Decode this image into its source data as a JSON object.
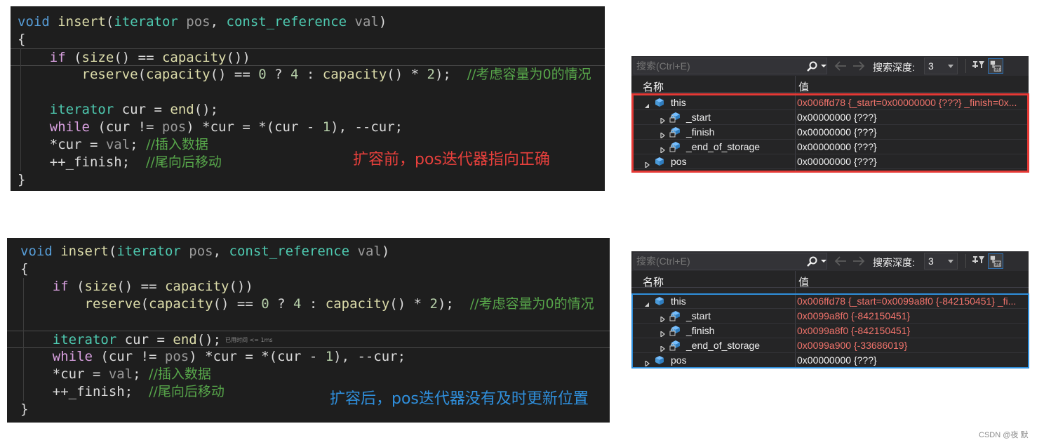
{
  "code_top": {
    "lines": [
      {
        "tokens": [
          {
            "c": "kw",
            "t": "void"
          },
          {
            "c": "var",
            "t": " "
          },
          {
            "c": "fn",
            "t": "insert"
          },
          {
            "c": "var",
            "t": "("
          },
          {
            "c": "ty",
            "t": "iterator"
          },
          {
            "c": "var",
            "t": " "
          },
          {
            "c": "prm",
            "t": "pos"
          },
          {
            "c": "var",
            "t": ", "
          },
          {
            "c": "ty",
            "t": "const_reference"
          },
          {
            "c": "var",
            "t": " "
          },
          {
            "c": "prm",
            "t": "val"
          },
          {
            "c": "var",
            "t": ")"
          }
        ]
      },
      {
        "tokens": [
          {
            "c": "var",
            "t": "{"
          }
        ]
      },
      {
        "tokens": [
          {
            "c": "var",
            "t": "    "
          },
          {
            "c": "ctl",
            "t": "if"
          },
          {
            "c": "var",
            "t": " ("
          },
          {
            "c": "fn",
            "t": "size"
          },
          {
            "c": "var",
            "t": "() == "
          },
          {
            "c": "fn",
            "t": "capacity"
          },
          {
            "c": "var",
            "t": "())"
          }
        ]
      },
      {
        "tokens": [
          {
            "c": "var",
            "t": "        "
          },
          {
            "c": "fn",
            "t": "reserve"
          },
          {
            "c": "var",
            "t": "("
          },
          {
            "c": "fn",
            "t": "capacity"
          },
          {
            "c": "var",
            "t": "() == "
          },
          {
            "c": "num",
            "t": "0"
          },
          {
            "c": "var",
            "t": " ? "
          },
          {
            "c": "num",
            "t": "4"
          },
          {
            "c": "var",
            "t": " : "
          },
          {
            "c": "fn",
            "t": "capacity"
          },
          {
            "c": "var",
            "t": "() * "
          },
          {
            "c": "num",
            "t": "2"
          },
          {
            "c": "var",
            "t": ");  "
          },
          {
            "c": "cm",
            "t": "//考虑容量为0的情况"
          }
        ]
      },
      {
        "tokens": [
          {
            "c": "var",
            "t": ""
          }
        ]
      },
      {
        "tokens": [
          {
            "c": "var",
            "t": "    "
          },
          {
            "c": "ty",
            "t": "iterator"
          },
          {
            "c": "var",
            "t": " "
          },
          {
            "c": "var",
            "t": "cur"
          },
          {
            "c": "var",
            "t": " = "
          },
          {
            "c": "fn",
            "t": "end"
          },
          {
            "c": "var",
            "t": "();"
          }
        ]
      },
      {
        "tokens": [
          {
            "c": "var",
            "t": "    "
          },
          {
            "c": "ctl",
            "t": "while"
          },
          {
            "c": "var",
            "t": " (cur != "
          },
          {
            "c": "prm",
            "t": "pos"
          },
          {
            "c": "var",
            "t": ") *cur = *(cur - "
          },
          {
            "c": "num",
            "t": "1"
          },
          {
            "c": "var",
            "t": "), --cur;"
          }
        ]
      },
      {
        "tokens": [
          {
            "c": "var",
            "t": "    *cur = "
          },
          {
            "c": "prm",
            "t": "val"
          },
          {
            "c": "var",
            "t": "; "
          },
          {
            "c": "cm",
            "t": "//插入数据"
          }
        ]
      },
      {
        "tokens": [
          {
            "c": "var",
            "t": "    ++_finish;  "
          },
          {
            "c": "cm",
            "t": "//尾向后移动"
          }
        ]
      },
      {
        "tokens": [
          {
            "c": "var",
            "t": "}"
          }
        ]
      }
    ],
    "annotation": "扩容前，pos迭代器指向正确"
  },
  "code_bottom": {
    "lines": [
      {
        "tokens": [
          {
            "c": "kw",
            "t": "void"
          },
          {
            "c": "var",
            "t": " "
          },
          {
            "c": "fn",
            "t": "insert"
          },
          {
            "c": "var",
            "t": "("
          },
          {
            "c": "ty",
            "t": "iterator"
          },
          {
            "c": "var",
            "t": " "
          },
          {
            "c": "prm",
            "t": "pos"
          },
          {
            "c": "var",
            "t": ", "
          },
          {
            "c": "ty",
            "t": "const_reference"
          },
          {
            "c": "var",
            "t": " "
          },
          {
            "c": "prm",
            "t": "val"
          },
          {
            "c": "var",
            "t": ")"
          }
        ]
      },
      {
        "tokens": [
          {
            "c": "var",
            "t": "{"
          }
        ]
      },
      {
        "tokens": [
          {
            "c": "var",
            "t": "    "
          },
          {
            "c": "ctl",
            "t": "if"
          },
          {
            "c": "var",
            "t": " ("
          },
          {
            "c": "fn",
            "t": "size"
          },
          {
            "c": "var",
            "t": "() == "
          },
          {
            "c": "fn",
            "t": "capacity"
          },
          {
            "c": "var",
            "t": "())"
          }
        ]
      },
      {
        "tokens": [
          {
            "c": "var",
            "t": "        "
          },
          {
            "c": "fn",
            "t": "reserve"
          },
          {
            "c": "var",
            "t": "("
          },
          {
            "c": "fn",
            "t": "capacity"
          },
          {
            "c": "var",
            "t": "() == "
          },
          {
            "c": "num",
            "t": "0"
          },
          {
            "c": "var",
            "t": " ? "
          },
          {
            "c": "num",
            "t": "4"
          },
          {
            "c": "var",
            "t": " : "
          },
          {
            "c": "fn",
            "t": "capacity"
          },
          {
            "c": "var",
            "t": "() * "
          },
          {
            "c": "num",
            "t": "2"
          },
          {
            "c": "var",
            "t": ");  "
          },
          {
            "c": "cm",
            "t": "//考虑容量为0的情况"
          }
        ]
      },
      {
        "tokens": [
          {
            "c": "var",
            "t": ""
          }
        ]
      },
      {
        "tokens": [
          {
            "c": "var",
            "t": "    "
          },
          {
            "c": "ty",
            "t": "iterator"
          },
          {
            "c": "var",
            "t": " "
          },
          {
            "c": "var",
            "t": "cur"
          },
          {
            "c": "var",
            "t": " = "
          },
          {
            "c": "fn",
            "t": "end"
          },
          {
            "c": "var",
            "t": "();"
          }
        ],
        "hint": "已用时间 <= 1ms"
      },
      {
        "tokens": [
          {
            "c": "var",
            "t": "    "
          },
          {
            "c": "ctl",
            "t": "while"
          },
          {
            "c": "var",
            "t": " (cur != "
          },
          {
            "c": "prm",
            "t": "pos"
          },
          {
            "c": "var",
            "t": ") *cur = *(cur - "
          },
          {
            "c": "num",
            "t": "1"
          },
          {
            "c": "var",
            "t": "), --cur;"
          }
        ]
      },
      {
        "tokens": [
          {
            "c": "var",
            "t": "    *cur = "
          },
          {
            "c": "prm",
            "t": "val"
          },
          {
            "c": "var",
            "t": "; "
          },
          {
            "c": "cm",
            "t": "//插入数据"
          }
        ]
      },
      {
        "tokens": [
          {
            "c": "var",
            "t": "    ++_finish;  "
          },
          {
            "c": "cm",
            "t": "//尾向后移动"
          }
        ]
      },
      {
        "tokens": [
          {
            "c": "var",
            "t": "}"
          }
        ]
      }
    ],
    "annotation": "扩容后，pos迭代器没有及时更新位置"
  },
  "watch_top": {
    "search_placeholder": "搜索(Ctrl+E)",
    "depth_label": "搜索深度:",
    "depth_value": "3",
    "col_name": "名称",
    "col_value": "值",
    "rows": [
      {
        "name": "this",
        "value": "0x006ffd78 {_start=0x00000000 {???} _finish=0x...",
        "changed": true,
        "level": 0,
        "expanded": true,
        "icon": "object-icon"
      },
      {
        "name": "_start",
        "value": "0x00000000 {???}",
        "changed": false,
        "level": 1,
        "expanded": false,
        "icon": "private-field-icon"
      },
      {
        "name": "_finish",
        "value": "0x00000000 {???}",
        "changed": false,
        "level": 1,
        "expanded": false,
        "icon": "private-field-icon"
      },
      {
        "name": "_end_of_storage",
        "value": "0x00000000 {???}",
        "changed": false,
        "level": 1,
        "expanded": false,
        "icon": "private-field-icon"
      },
      {
        "name": "pos",
        "value": "0x00000000 {???}",
        "changed": false,
        "level": 0,
        "expanded": false,
        "icon": "object-icon"
      }
    ]
  },
  "watch_bottom": {
    "search_placeholder": "搜索(Ctrl+E)",
    "depth_label": "搜索深度:",
    "depth_value": "3",
    "col_name": "名称",
    "col_value": "值",
    "rows": [
      {
        "name": "this",
        "value": "0x006ffd78 {_start=0x0099a8f0 {-842150451} _fi...",
        "changed": true,
        "level": 0,
        "expanded": true,
        "icon": "object-icon"
      },
      {
        "name": "_start",
        "value": "0x0099a8f0 {-842150451}",
        "changed": true,
        "level": 1,
        "expanded": false,
        "icon": "private-field-icon"
      },
      {
        "name": "_finish",
        "value": "0x0099a8f0 {-842150451}",
        "changed": true,
        "level": 1,
        "expanded": false,
        "icon": "private-field-icon"
      },
      {
        "name": "_end_of_storage",
        "value": "0x0099a900 {-33686019}",
        "changed": true,
        "level": 1,
        "expanded": false,
        "icon": "private-field-icon"
      },
      {
        "name": "pos",
        "value": "0x00000000 {???}",
        "changed": false,
        "level": 0,
        "expanded": false,
        "icon": "object-icon"
      }
    ]
  },
  "colors": {
    "frame_top": "#e53935",
    "frame_bottom": "#2f8fdc",
    "annot_top": "#e8403c",
    "annot_bottom": "#2f8fdc",
    "changed_value": "#f0736b"
  },
  "watermark": "CSDN @夜 默"
}
